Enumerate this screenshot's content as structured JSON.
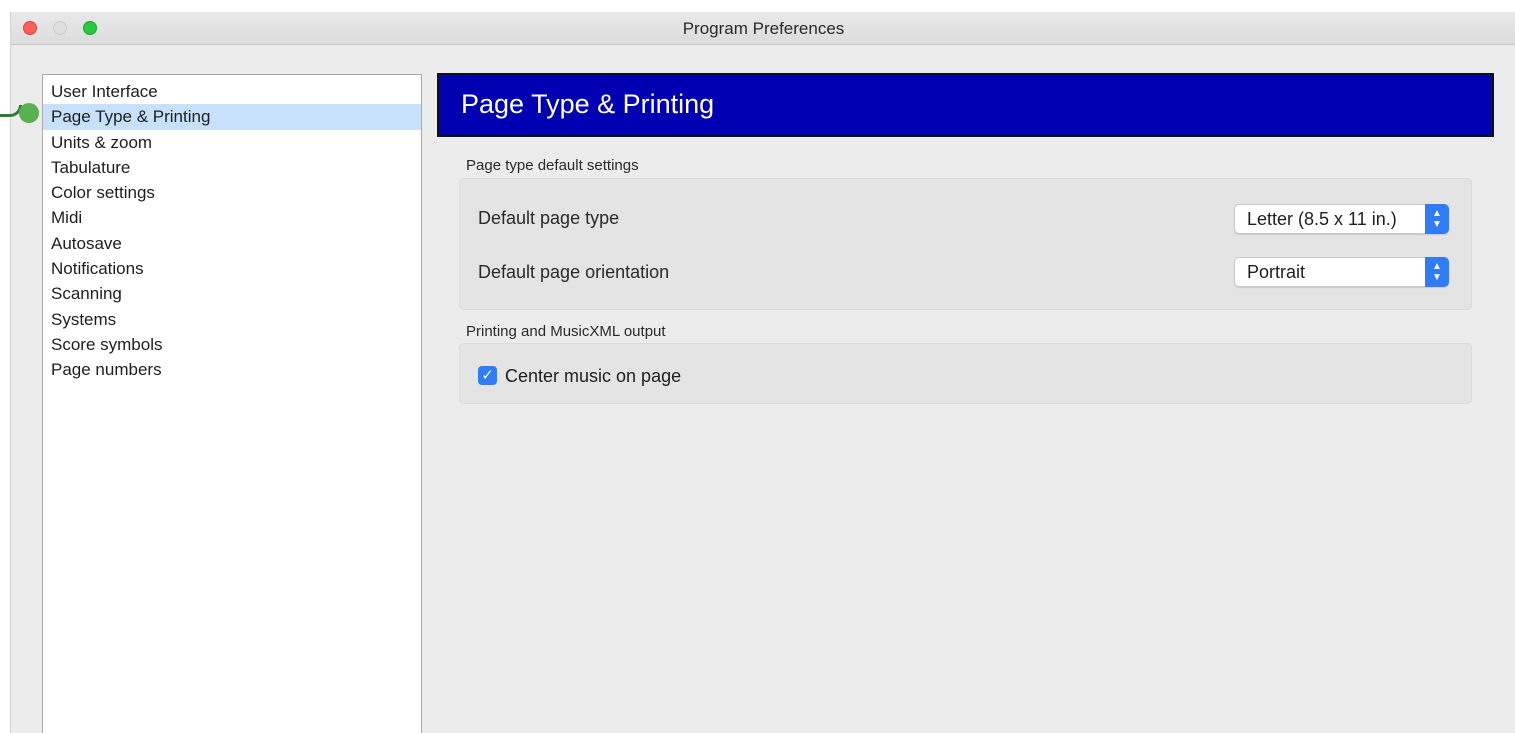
{
  "window": {
    "title": "Program Preferences"
  },
  "sidebar": {
    "items": [
      {
        "label": "User Interface"
      },
      {
        "label": "Page Type & Printing",
        "selected": true
      },
      {
        "label": "Units & zoom"
      },
      {
        "label": "Tabulature"
      },
      {
        "label": "Color settings"
      },
      {
        "label": "Midi"
      },
      {
        "label": "Autosave"
      },
      {
        "label": "Notifications"
      },
      {
        "label": "Scanning"
      },
      {
        "label": "Systems"
      },
      {
        "label": "Score symbols"
      },
      {
        "label": "Page numbers"
      }
    ]
  },
  "panel": {
    "title": "Page Type & Printing",
    "header_color": "#0000b2",
    "page_type_group": {
      "label": "Page type default settings",
      "page_type_label": "Default page type",
      "page_type_value": "Letter (8.5 x 11 in.)",
      "orientation_label": "Default page orientation",
      "orientation_value": "Portrait"
    },
    "printing_group": {
      "label": "Printing and MusicXML output",
      "center_music_label": "Center music on page",
      "center_music_checked": true
    }
  },
  "colors": {
    "accent": "#2f7cf6",
    "selection": "#c7e0fb",
    "annotation": "#58b04f"
  }
}
